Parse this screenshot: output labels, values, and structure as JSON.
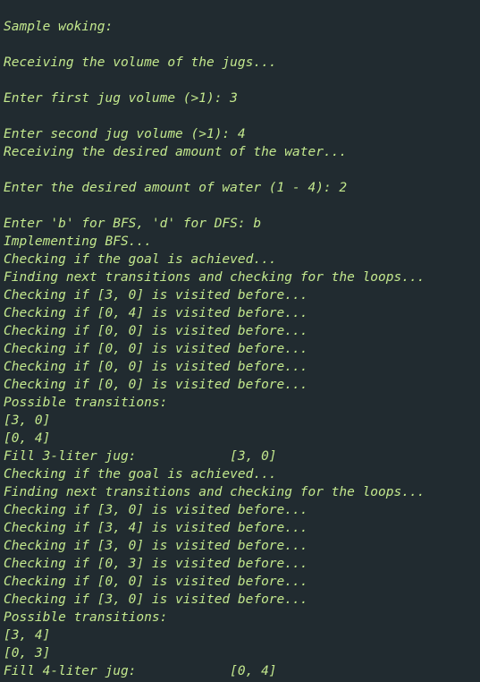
{
  "editor": {
    "top_mark": "'''",
    "lines": [
      "Sample woking:",
      "",
      "Receiving the volume of the jugs...",
      "",
      "Enter first jug volume (>1): 3",
      "",
      "Enter second jug volume (>1): 4",
      "Receiving the desired amount of the water...",
      "",
      "Enter the desired amount of water (1 - 4): 2",
      "",
      "Enter 'b' for BFS, 'd' for DFS: b",
      "Implementing BFS...",
      "Checking if the goal is achieved...",
      "Finding next transitions and checking for the loops...",
      "Checking if [3, 0] is visited before...",
      "Checking if [0, 4] is visited before...",
      "Checking if [0, 0] is visited before...",
      "Checking if [0, 0] is visited before...",
      "Checking if [0, 0] is visited before...",
      "Checking if [0, 0] is visited before...",
      "Possible transitions:",
      "[3, 0]",
      "[0, 4]",
      "Fill 3-liter jug:            [3, 0]",
      "Checking if the goal is achieved...",
      "Finding next transitions and checking for the loops...",
      "Checking if [3, 0] is visited before...",
      "Checking if [3, 4] is visited before...",
      "Checking if [3, 0] is visited before...",
      "Checking if [0, 3] is visited before...",
      "Checking if [0, 0] is visited before...",
      "Checking if [3, 0] is visited before...",
      "Possible transitions:",
      "[3, 4]",
      "[0, 3]",
      "Fill 4-liter jug:            [0, 4]"
    ]
  },
  "colors": {
    "background": "#212b30",
    "text": "#c3e88d"
  }
}
